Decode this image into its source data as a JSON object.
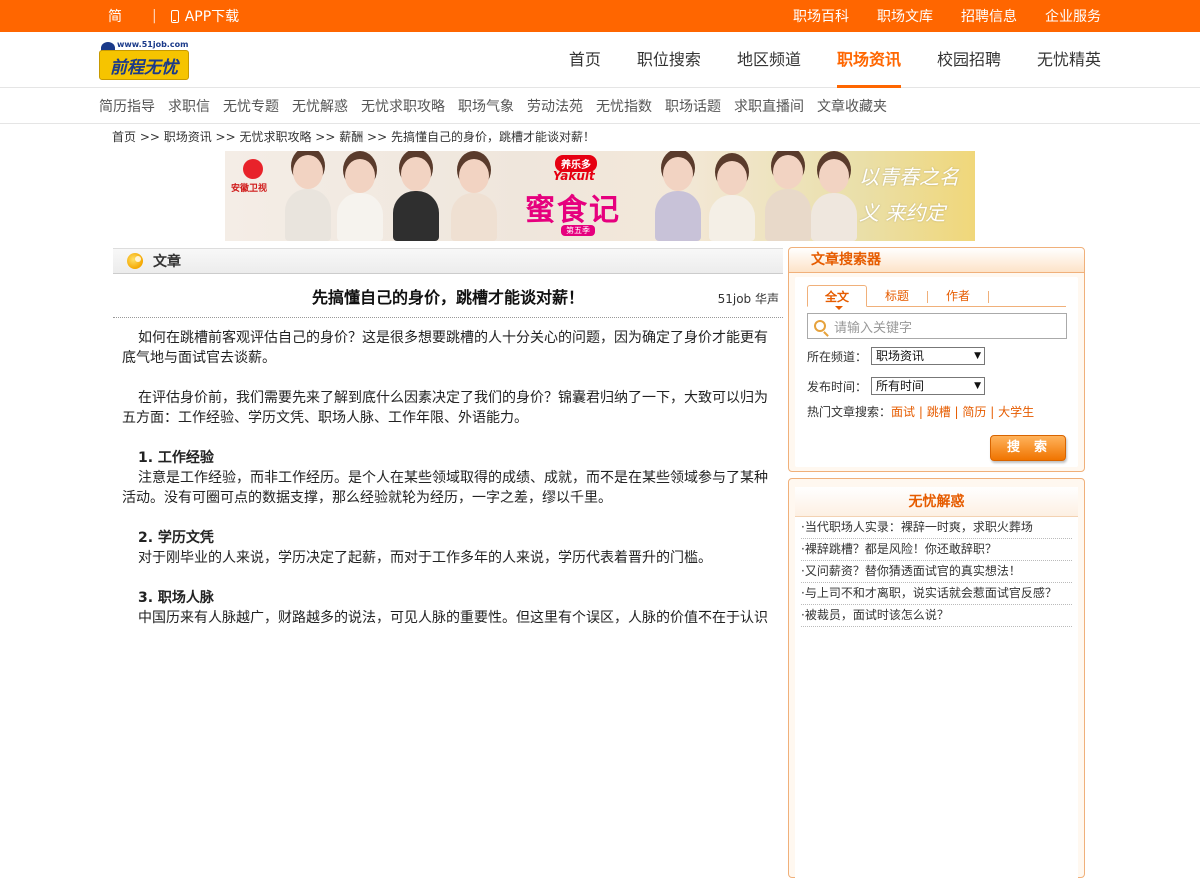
{
  "topbar": {
    "lang": "简",
    "app_download": "APP下载",
    "links": [
      "职场百科",
      "职场文库",
      "招聘信息",
      "企业服务"
    ]
  },
  "header": {
    "logo_url": "www.51job.com",
    "logo_text": "前程无忧",
    "nav": [
      "首页",
      "职位搜索",
      "地区频道",
      "职场资讯",
      "校园招聘",
      "无忧精英"
    ],
    "active_nav": "职场资讯"
  },
  "subnav": [
    "简历指导",
    "求职信",
    "无忧专题",
    "无忧解惑",
    "无忧求职攻略",
    "职场气象",
    "劳动法苑",
    "无忧指数",
    "职场话题",
    "求职直播间",
    "文章收藏夹"
  ],
  "breadcrumb": "首页 >> 职场资讯 >> 无忧求职攻略 >> 薪酬 >> 先搞懂自己的身价，跳槽才能谈对薪！",
  "banner": {
    "channel_logo": "安徽卫视",
    "brand_cn": "养乐多",
    "brand_en": "Yakult",
    "show_title": "蜜食记",
    "season": "第五季",
    "slogan": "以青春之名义 来约定"
  },
  "article": {
    "section_label": "文章",
    "title": "先搞懂自己的身价，跳槽才能谈对薪！",
    "author": "51job 华声",
    "p1": "如何在跳槽前客观评估自己的身价？这是很多想要跳槽的人十分关心的问题，因为确定了身价才能更有底气地与面试官去谈薪。",
    "p2": "在评估身价前，我们需要先来了解到底什么因素决定了我们的身价？锦囊君归纳了一下，大致可以归为五方面：工作经验、学历文凭、职场人脉、工作年限、外语能力。",
    "h1": "1. 工作经验",
    "b1": "注意是工作经验，而非工作经历。是个人在某些领域取得的成绩、成就，而不是在某些领域参与了某种活动。没有可圈可点的数据支撑，那么经验就轮为经历，一字之差，缪以千里。",
    "h2": "2. 学历文凭",
    "b2": "对于刚毕业的人来说，学历决定了起薪，而对于工作多年的人来说，学历代表着晋升的门槛。",
    "h3": "3. 职场人脉",
    "b3": "中国历来有人脉越广，财路越多的说法，可见人脉的重要性。但这里有个误区，人脉的价值不在于认识"
  },
  "search_panel": {
    "title": "文章搜索器",
    "tabs": [
      "全文",
      "标题",
      "作者"
    ],
    "placeholder": "请输入关键字",
    "channel_label": "所在频道：",
    "channel_value": "职场资讯",
    "time_label": "发布时间：",
    "time_value": "所有时间",
    "hot_label": "热门文章搜索：",
    "hot_links": [
      "面试",
      "跳槽",
      "简历",
      "大学生"
    ],
    "button": "搜索"
  },
  "faq": {
    "title": "无忧解惑",
    "items": [
      "·当代职场人实录：裸辞一时爽，求职火葬场",
      "·裸辞跳槽？都是风险！你还敢辞职？",
      "·又问薪资？替你猜透面试官的真实想法！",
      "·与上司不和才离职，说实话就会惹面试官反感？",
      "·被裁员，面试时该怎么说？"
    ]
  }
}
